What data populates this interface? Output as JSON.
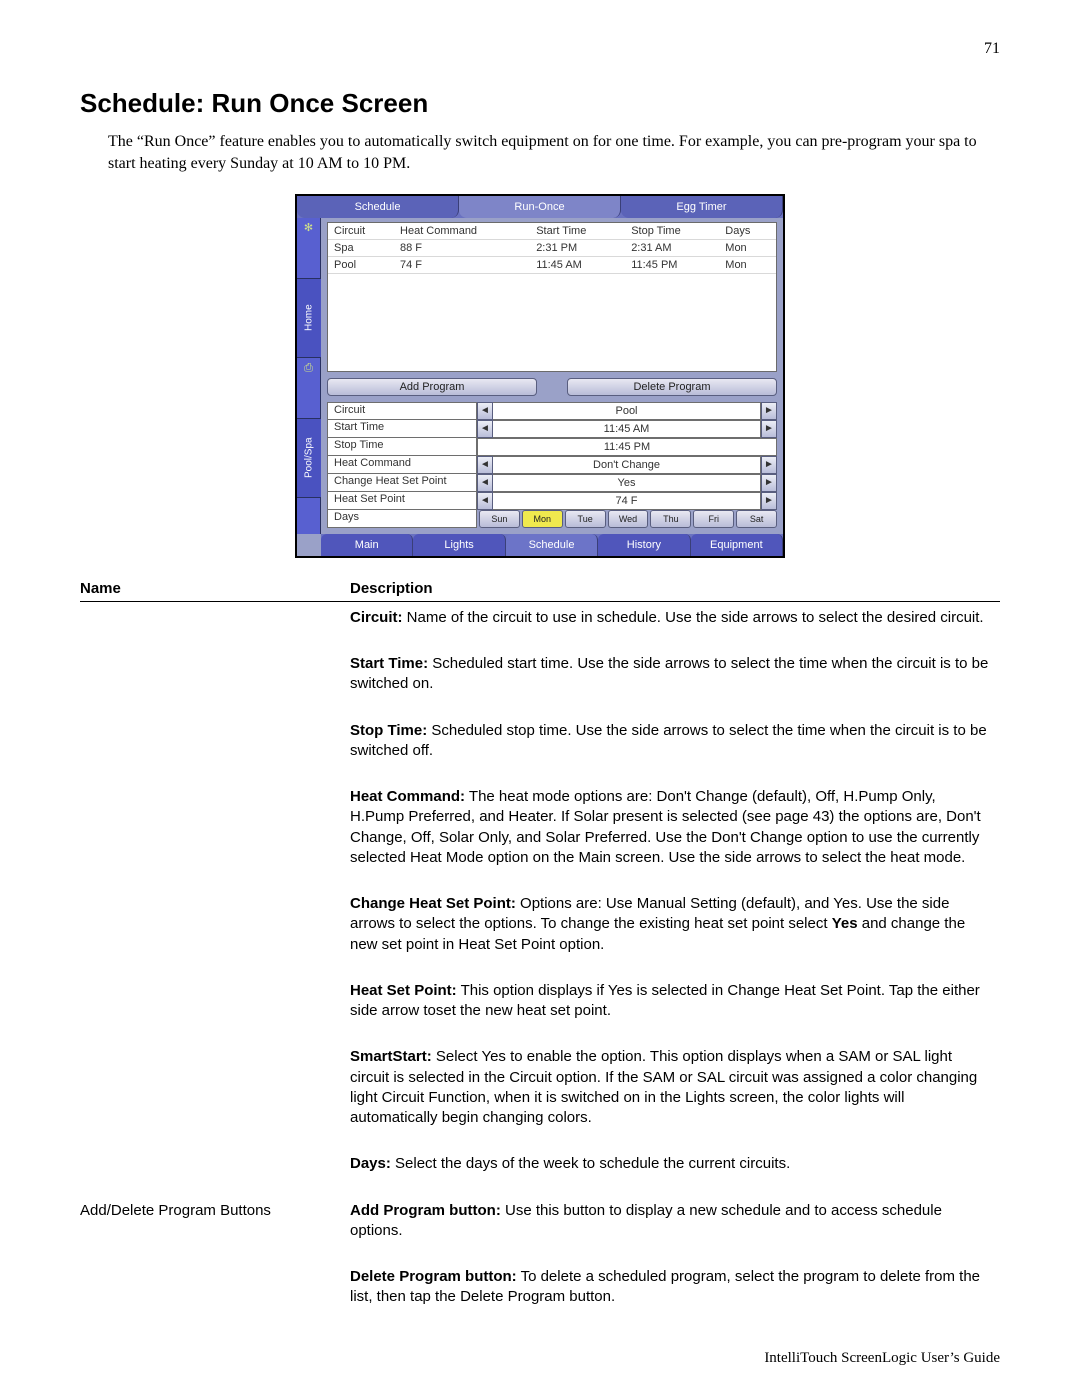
{
  "page_number": "71",
  "title": "Schedule: Run Once Screen",
  "intro": "The “Run Once” feature enables you to automatically switch equipment on for one time. For example, you can pre-program your spa to start heating every Sunday at 10 AM  to 10 PM.",
  "ui": {
    "top_tabs": [
      "Schedule",
      "Run-Once",
      "Egg Timer"
    ],
    "active_top_tab": 1,
    "left_rail": {
      "icon_top": "✻",
      "home": "Home",
      "print_icon": "⎙",
      "poolspa": "Pool/Spa"
    },
    "program_table": {
      "headers": [
        "Circuit",
        "Heat Command",
        "Start Time",
        "Stop Time",
        "Days"
      ],
      "rows": [
        [
          "Spa",
          "88 F",
          "2:31  PM",
          "2:31  AM",
          "Mon"
        ],
        [
          "Pool",
          "74 F",
          "11:45  AM",
          "11:45  PM",
          "Mon"
        ]
      ]
    },
    "add_program_btn": "Add Program",
    "delete_program_btn": "Delete Program",
    "settings": [
      {
        "label": "Circuit",
        "value": "Pool",
        "arrows": "both"
      },
      {
        "label": "Start Time",
        "value": "11:45  AM",
        "arrows": "both"
      },
      {
        "label": "Stop Time",
        "value": "11:45  PM",
        "arrows": "none"
      },
      {
        "label": "Heat Command",
        "value": "Don't Change",
        "arrows": "both"
      },
      {
        "label": "Change Heat Set Point",
        "value": "Yes",
        "arrows": "both"
      },
      {
        "label": "Heat Set Point",
        "value": "74 F",
        "arrows": "both"
      }
    ],
    "days_label": "Days",
    "days": [
      "Sun",
      "Mon",
      "Tue",
      "Wed",
      "Thu",
      "Fri",
      "Sat"
    ],
    "day_selected": "Mon",
    "bottom_tabs": [
      "Main",
      "Lights",
      "Schedule",
      "History",
      "Equipment"
    ],
    "active_bottom_tab": 2
  },
  "table_headers": {
    "name": "Name",
    "description": "Description"
  },
  "descriptions": [
    {
      "name": "",
      "lead": "Circuit:",
      "text": " Name of the circuit to use in schedule. Use the side arrows to select the desired circuit."
    },
    {
      "name": "",
      "lead": "Start Time:",
      "text": " Scheduled start time. Use the side arrows to select the time when the circuit is to be switched on."
    },
    {
      "name": "",
      "lead": "Stop Time:",
      "text": " Scheduled stop time. Use the side arrows to select the time when the circuit is to be switched off."
    },
    {
      "name": "",
      "lead": "Heat Command:",
      "text": " The heat mode options are:  Don't Change (default), Off, H.Pump Only, H.Pump Preferred, and Heater. If Solar present is selected (see page 43) the options are, Don't Change, Off, Solar Only, and Solar Preferred.  Use the Don't Change option to use the currently selected Heat Mode option on the Main screen. Use the side arrows to select the heat mode."
    },
    {
      "name": "",
      "lead": "Change Heat Set Point:",
      "text_pre": " Options are: Use Manual Setting (default), and Yes. Use the side arrows to select the options. To change the existing heat set point select  ",
      "bold_mid": "Yes",
      "text_post": " and change the new set point in Heat Set Point option."
    },
    {
      "name": "",
      "lead": "Heat Set Point:",
      "text": " This option displays if Yes is selected in Change Heat Set Point. Tap the either side arrow toset the new heat set point."
    },
    {
      "name": "",
      "lead": "SmartStart:",
      "text": " Select Yes to enable the option. This option displays when a SAM or SAL light circuit is selected in the Circuit option. If the SAM or SAL circuit was assigned a color changing light Circuit Function, when it is switched on in the Lights screen, the color lights will automatically begin changing colors."
    },
    {
      "name": "",
      "lead": "Days:",
      "text": " Select the days of the week to schedule the current circuits."
    },
    {
      "name": "Add/Delete Program Buttons",
      "lead": "Add Program button:",
      "text": " Use this button to display a new schedule and to access schedule options."
    },
    {
      "name": "",
      "lead": "Delete Program button:",
      "text": " To delete a scheduled program, select the program to delete from the list, then tap the  Delete Program button."
    }
  ],
  "footer": "IntelliTouch ScreenLogic User’s Guide"
}
